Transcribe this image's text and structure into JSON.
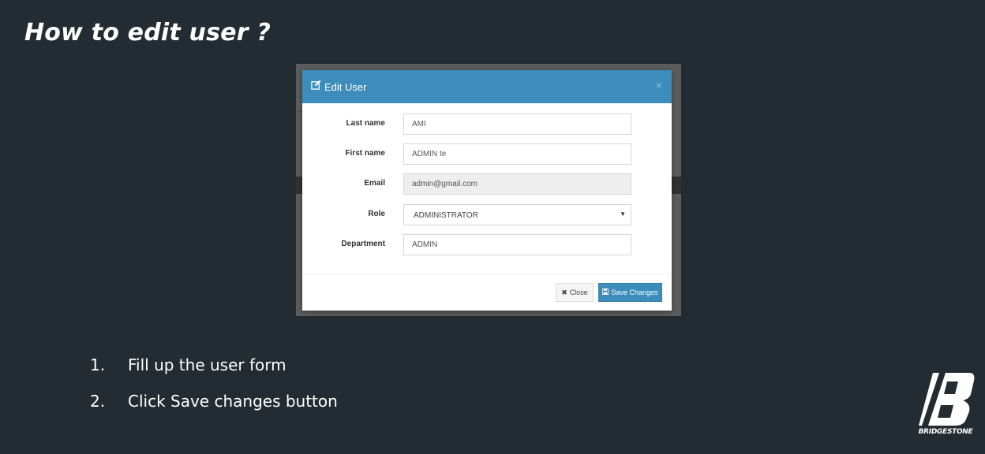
{
  "slide": {
    "title": "How to edit user ?",
    "steps": [
      {
        "num": "1.",
        "text": "Fill up the user form"
      },
      {
        "num": "2.",
        "text": "Click Save changes button"
      }
    ]
  },
  "modal": {
    "title": "Edit User",
    "close_glyph": "×",
    "fields": {
      "last_name": {
        "label": "Last name",
        "value": "AMI"
      },
      "first_name": {
        "label": "First name",
        "value": "ADMIN te"
      },
      "email": {
        "label": "Email",
        "value": "admin@gmail.com"
      },
      "role": {
        "label": "Role",
        "value": "ADMINISTRATOR"
      },
      "department": {
        "label": "Department",
        "value": "ADMIN"
      }
    },
    "buttons": {
      "close": "Close",
      "save": "Save Changes"
    }
  },
  "brand": {
    "logo_text": "BRIDGESTONE"
  },
  "colors": {
    "background": "#232c32",
    "header": "#3c8dbc",
    "primary_button": "#3c8dbc"
  },
  "icons": [
    "edit-icon",
    "close-icon",
    "times-icon",
    "save-icon",
    "caret-down-icon"
  ]
}
